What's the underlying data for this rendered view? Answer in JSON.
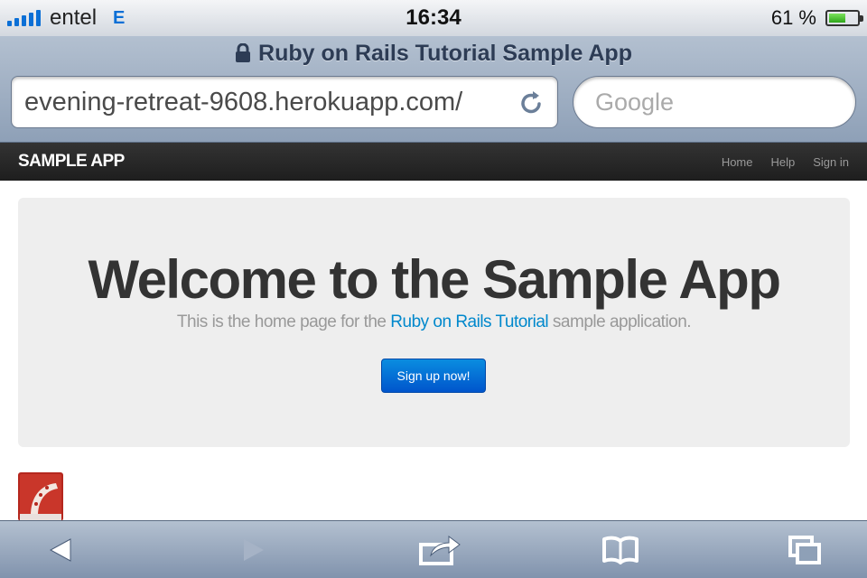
{
  "status_bar": {
    "carrier": "entel",
    "network": "E",
    "time": "16:34",
    "battery_percent": "61 %",
    "battery_level": 0.61
  },
  "browser": {
    "page_title": "Ruby on Rails Tutorial Sample App",
    "url": "evening-retreat-9608.herokuapp.com/",
    "search_placeholder": "Google"
  },
  "navbar": {
    "brand": "SAMPLE APP",
    "links": [
      "Home",
      "Help",
      "Sign in"
    ]
  },
  "hero": {
    "title": "Welcome to the Sample App",
    "subtitle_before": "This is the home page for the ",
    "subtitle_link": "Ruby on Rails Tutorial",
    "subtitle_after": " sample application.",
    "button": "Sign up now!"
  },
  "footer_logo": "rails-logo",
  "toolbar": {
    "icons": [
      "back-icon",
      "forward-icon",
      "share-icon",
      "bookmarks-icon",
      "tabs-icon"
    ]
  },
  "colors": {
    "link": "#0088cc",
    "button": "#0055cc",
    "navbar": "#222222",
    "hero_bg": "#eeeeee"
  }
}
